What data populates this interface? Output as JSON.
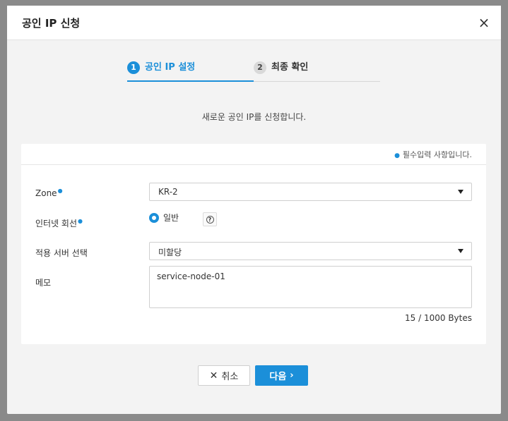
{
  "dialog": {
    "title": "공인 IP 신청",
    "close_icon": "×"
  },
  "steps": [
    {
      "number": "1",
      "label": "공인 IP 설정",
      "active": true
    },
    {
      "number": "2",
      "label": "최종 확인",
      "active": false
    }
  ],
  "intro_text": "새로운 공인 IP를 신청합니다.",
  "required_note": "필수입력 사항입니다.",
  "form": {
    "zone": {
      "label": "Zone",
      "value": "KR-2",
      "required": true
    },
    "internet_line": {
      "label": "인터넷 회선",
      "option_label": "일반",
      "selected": true,
      "required": true,
      "help_icon": "?"
    },
    "server": {
      "label": "적용 서버 선택",
      "value": "미할당"
    },
    "memo": {
      "label": "메모",
      "value": "service-node-01",
      "byte_count": "15 / 1000 Bytes"
    }
  },
  "buttons": {
    "cancel_label": "취소",
    "next_label": "다음"
  },
  "colors": {
    "accent": "#1b8fd9",
    "overlay": "#8a8a8a"
  }
}
